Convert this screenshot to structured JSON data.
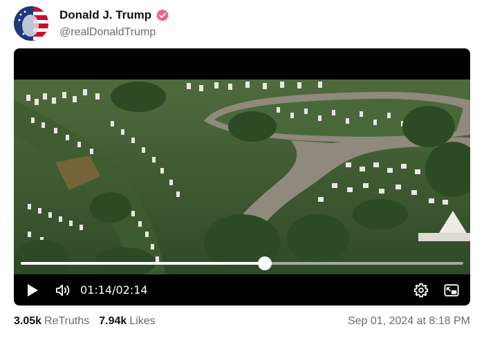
{
  "post": {
    "display_name": "Donald J. Trump",
    "handle": "@realDonaldTrump",
    "verified_badge": "verified-badge-icon",
    "accent_color": "#f45e7a"
  },
  "video": {
    "current_time": "01:14",
    "separator": "/",
    "duration": "02:14",
    "progress_fraction": 0.552
  },
  "stats": {
    "retruths_count": "3.05k",
    "retruths_label": "ReTruths",
    "likes_count": "7.94k",
    "likes_label": "Likes"
  },
  "timestamp": "Sep 01, 2024 at 8:18 PM",
  "icons": {
    "play": "play-icon",
    "volume": "volume-icon",
    "settings": "gear-icon",
    "pip": "picture-in-picture-icon"
  }
}
